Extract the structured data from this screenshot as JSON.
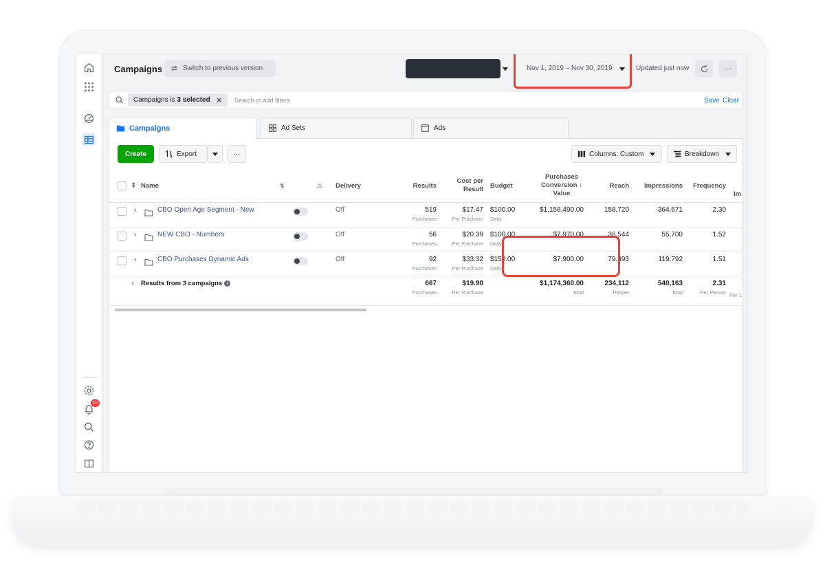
{
  "header": {
    "title": "Campaigns",
    "switch_label": "Switch to previous version",
    "date_range": "Nov 1, 2019 – Nov 30, 2019",
    "updated": "Updated just now",
    "more_label": "···"
  },
  "filter": {
    "chip_prefix": "Campaigns is ",
    "chip_bold": "3 selected",
    "chip_close": "✕",
    "placeholder": "Search or add filters",
    "save": "Save",
    "clear": "Clear"
  },
  "tabs": [
    {
      "label": "Campaigns",
      "icon": "folder-icon",
      "active": true
    },
    {
      "label": "Ad Sets",
      "icon": "grid-icon",
      "active": false
    },
    {
      "label": "Ads",
      "icon": "ad-icon",
      "active": false
    }
  ],
  "toolbar": {
    "create": "Create",
    "export": "Export",
    "more": "···",
    "columns": "Columns: Custom",
    "breakdown": "Breakdown"
  },
  "table": {
    "headers": {
      "name": "Name",
      "delivery": "Delivery",
      "results": "Results",
      "cost_l1": "Cost per",
      "cost_l2": "Result",
      "budget": "Budget",
      "pcv_l1": "Purchases",
      "pcv_l2": "Conversion ↓",
      "pcv_l3": "Value",
      "reach": "Reach",
      "impressions": "Impressions",
      "frequency": "Frequency",
      "im": "Im"
    },
    "rows": [
      {
        "name": "CBO Open Age Segment - New",
        "delivery": "Off",
        "results": "519",
        "results_sub": "Purchases",
        "cost": "$17.47",
        "cost_sub": "Per Purchase",
        "budget": "$100.00",
        "budget_sub": "Daily",
        "pcv": "$1,158,490.00",
        "reach": "158,720",
        "impressions": "364,671",
        "frequency": "2.30"
      },
      {
        "name": "NEW CBO - Numbers",
        "delivery": "Off",
        "results": "56",
        "results_sub": "Purchases",
        "cost": "$20.39",
        "cost_sub": "Per Purchase",
        "budget": "$100.00",
        "budget_sub": "Daily",
        "pcv": "$7,970.00",
        "reach": "36,544",
        "impressions": "55,700",
        "frequency": "1.52"
      },
      {
        "name": "CBO Purchases Dynamic Ads",
        "delivery": "Off",
        "results": "92",
        "results_sub": "Purchases",
        "cost": "$33.32",
        "cost_sub": "Per Purchase",
        "budget": "$150.00",
        "budget_sub": "Daily",
        "pcv": "$7,900.00",
        "reach": "79,393",
        "impressions": "119,792",
        "frequency": "1.51"
      }
    ],
    "totals": {
      "label": "Results from 3 campaigns",
      "results": "667",
      "results_sub": "Purchases",
      "cost": "$19.90",
      "cost_sub": "Per Purchase",
      "pcv": "$1,174,360.00",
      "pcv_sub": "Total",
      "reach": "234,112",
      "reach_sub": "People",
      "impressions": "540,163",
      "impressions_sub": "Total",
      "frequency": "2.31",
      "frequency_sub": "Per Person",
      "im_sub": "Per 1"
    }
  },
  "nav": {
    "badge": "10"
  },
  "colors": {
    "accent": "#1877f2",
    "create": "#00a400",
    "highlight": "#e8413a"
  }
}
